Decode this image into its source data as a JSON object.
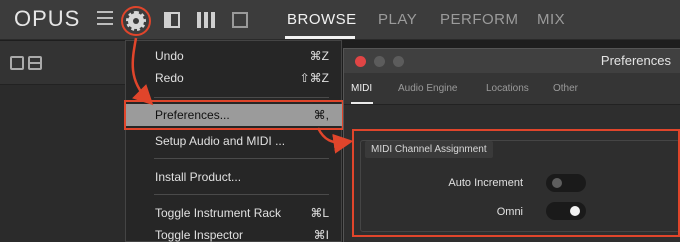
{
  "app": {
    "logo": "OPUS",
    "nav": [
      {
        "label": "BROWSE",
        "active": true
      },
      {
        "label": "PLAY",
        "active": false
      },
      {
        "label": "PERFORM",
        "active": false
      },
      {
        "label": "MIX",
        "active": false
      }
    ]
  },
  "menu": {
    "items": [
      {
        "label": "Undo",
        "shortcut": "⌘Z"
      },
      {
        "label": "Redo",
        "shortcut": "⇧⌘Z"
      },
      {
        "label": "Preferences...",
        "shortcut": "⌘,"
      },
      {
        "label": "Setup Audio and MIDI ...",
        "shortcut": ""
      },
      {
        "label": "Install Product...",
        "shortcut": ""
      },
      {
        "label": "Toggle Instrument Rack",
        "shortcut": "⌘L"
      },
      {
        "label": "Toggle Inspector",
        "shortcut": "⌘I"
      }
    ]
  },
  "preferences": {
    "title": "Preferences",
    "tabs": [
      {
        "label": "MIDI",
        "active": true
      },
      {
        "label": "Audio Engine",
        "active": false
      },
      {
        "label": "Locations",
        "active": false
      },
      {
        "label": "Other",
        "active": false
      }
    ],
    "section_title": "MIDI Channel Assignment",
    "rows": [
      {
        "label": "Auto Increment",
        "on": false
      },
      {
        "label": "Omni",
        "on": true
      }
    ]
  },
  "colors": {
    "highlight": "#e0452b",
    "close_button": "#e04545"
  }
}
